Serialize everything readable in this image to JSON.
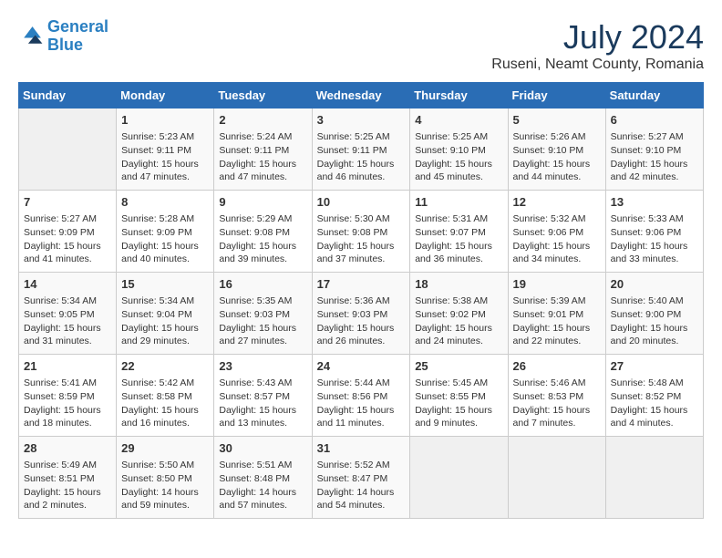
{
  "header": {
    "logo_line1": "General",
    "logo_line2": "Blue",
    "month_year": "July 2024",
    "location": "Ruseni, Neamt County, Romania"
  },
  "weekdays": [
    "Sunday",
    "Monday",
    "Tuesday",
    "Wednesday",
    "Thursday",
    "Friday",
    "Saturday"
  ],
  "weeks": [
    [
      {
        "day": "",
        "info": ""
      },
      {
        "day": "1",
        "info": "Sunrise: 5:23 AM\nSunset: 9:11 PM\nDaylight: 15 hours\nand 47 minutes."
      },
      {
        "day": "2",
        "info": "Sunrise: 5:24 AM\nSunset: 9:11 PM\nDaylight: 15 hours\nand 47 minutes."
      },
      {
        "day": "3",
        "info": "Sunrise: 5:25 AM\nSunset: 9:11 PM\nDaylight: 15 hours\nand 46 minutes."
      },
      {
        "day": "4",
        "info": "Sunrise: 5:25 AM\nSunset: 9:10 PM\nDaylight: 15 hours\nand 45 minutes."
      },
      {
        "day": "5",
        "info": "Sunrise: 5:26 AM\nSunset: 9:10 PM\nDaylight: 15 hours\nand 44 minutes."
      },
      {
        "day": "6",
        "info": "Sunrise: 5:27 AM\nSunset: 9:10 PM\nDaylight: 15 hours\nand 42 minutes."
      }
    ],
    [
      {
        "day": "7",
        "info": "Sunrise: 5:27 AM\nSunset: 9:09 PM\nDaylight: 15 hours\nand 41 minutes."
      },
      {
        "day": "8",
        "info": "Sunrise: 5:28 AM\nSunset: 9:09 PM\nDaylight: 15 hours\nand 40 minutes."
      },
      {
        "day": "9",
        "info": "Sunrise: 5:29 AM\nSunset: 9:08 PM\nDaylight: 15 hours\nand 39 minutes."
      },
      {
        "day": "10",
        "info": "Sunrise: 5:30 AM\nSunset: 9:08 PM\nDaylight: 15 hours\nand 37 minutes."
      },
      {
        "day": "11",
        "info": "Sunrise: 5:31 AM\nSunset: 9:07 PM\nDaylight: 15 hours\nand 36 minutes."
      },
      {
        "day": "12",
        "info": "Sunrise: 5:32 AM\nSunset: 9:06 PM\nDaylight: 15 hours\nand 34 minutes."
      },
      {
        "day": "13",
        "info": "Sunrise: 5:33 AM\nSunset: 9:06 PM\nDaylight: 15 hours\nand 33 minutes."
      }
    ],
    [
      {
        "day": "14",
        "info": "Sunrise: 5:34 AM\nSunset: 9:05 PM\nDaylight: 15 hours\nand 31 minutes."
      },
      {
        "day": "15",
        "info": "Sunrise: 5:34 AM\nSunset: 9:04 PM\nDaylight: 15 hours\nand 29 minutes."
      },
      {
        "day": "16",
        "info": "Sunrise: 5:35 AM\nSunset: 9:03 PM\nDaylight: 15 hours\nand 27 minutes."
      },
      {
        "day": "17",
        "info": "Sunrise: 5:36 AM\nSunset: 9:03 PM\nDaylight: 15 hours\nand 26 minutes."
      },
      {
        "day": "18",
        "info": "Sunrise: 5:38 AM\nSunset: 9:02 PM\nDaylight: 15 hours\nand 24 minutes."
      },
      {
        "day": "19",
        "info": "Sunrise: 5:39 AM\nSunset: 9:01 PM\nDaylight: 15 hours\nand 22 minutes."
      },
      {
        "day": "20",
        "info": "Sunrise: 5:40 AM\nSunset: 9:00 PM\nDaylight: 15 hours\nand 20 minutes."
      }
    ],
    [
      {
        "day": "21",
        "info": "Sunrise: 5:41 AM\nSunset: 8:59 PM\nDaylight: 15 hours\nand 18 minutes."
      },
      {
        "day": "22",
        "info": "Sunrise: 5:42 AM\nSunset: 8:58 PM\nDaylight: 15 hours\nand 16 minutes."
      },
      {
        "day": "23",
        "info": "Sunrise: 5:43 AM\nSunset: 8:57 PM\nDaylight: 15 hours\nand 13 minutes."
      },
      {
        "day": "24",
        "info": "Sunrise: 5:44 AM\nSunset: 8:56 PM\nDaylight: 15 hours\nand 11 minutes."
      },
      {
        "day": "25",
        "info": "Sunrise: 5:45 AM\nSunset: 8:55 PM\nDaylight: 15 hours\nand 9 minutes."
      },
      {
        "day": "26",
        "info": "Sunrise: 5:46 AM\nSunset: 8:53 PM\nDaylight: 15 hours\nand 7 minutes."
      },
      {
        "day": "27",
        "info": "Sunrise: 5:48 AM\nSunset: 8:52 PM\nDaylight: 15 hours\nand 4 minutes."
      }
    ],
    [
      {
        "day": "28",
        "info": "Sunrise: 5:49 AM\nSunset: 8:51 PM\nDaylight: 15 hours\nand 2 minutes."
      },
      {
        "day": "29",
        "info": "Sunrise: 5:50 AM\nSunset: 8:50 PM\nDaylight: 14 hours\nand 59 minutes."
      },
      {
        "day": "30",
        "info": "Sunrise: 5:51 AM\nSunset: 8:48 PM\nDaylight: 14 hours\nand 57 minutes."
      },
      {
        "day": "31",
        "info": "Sunrise: 5:52 AM\nSunset: 8:47 PM\nDaylight: 14 hours\nand 54 minutes."
      },
      {
        "day": "",
        "info": ""
      },
      {
        "day": "",
        "info": ""
      },
      {
        "day": "",
        "info": ""
      }
    ]
  ]
}
